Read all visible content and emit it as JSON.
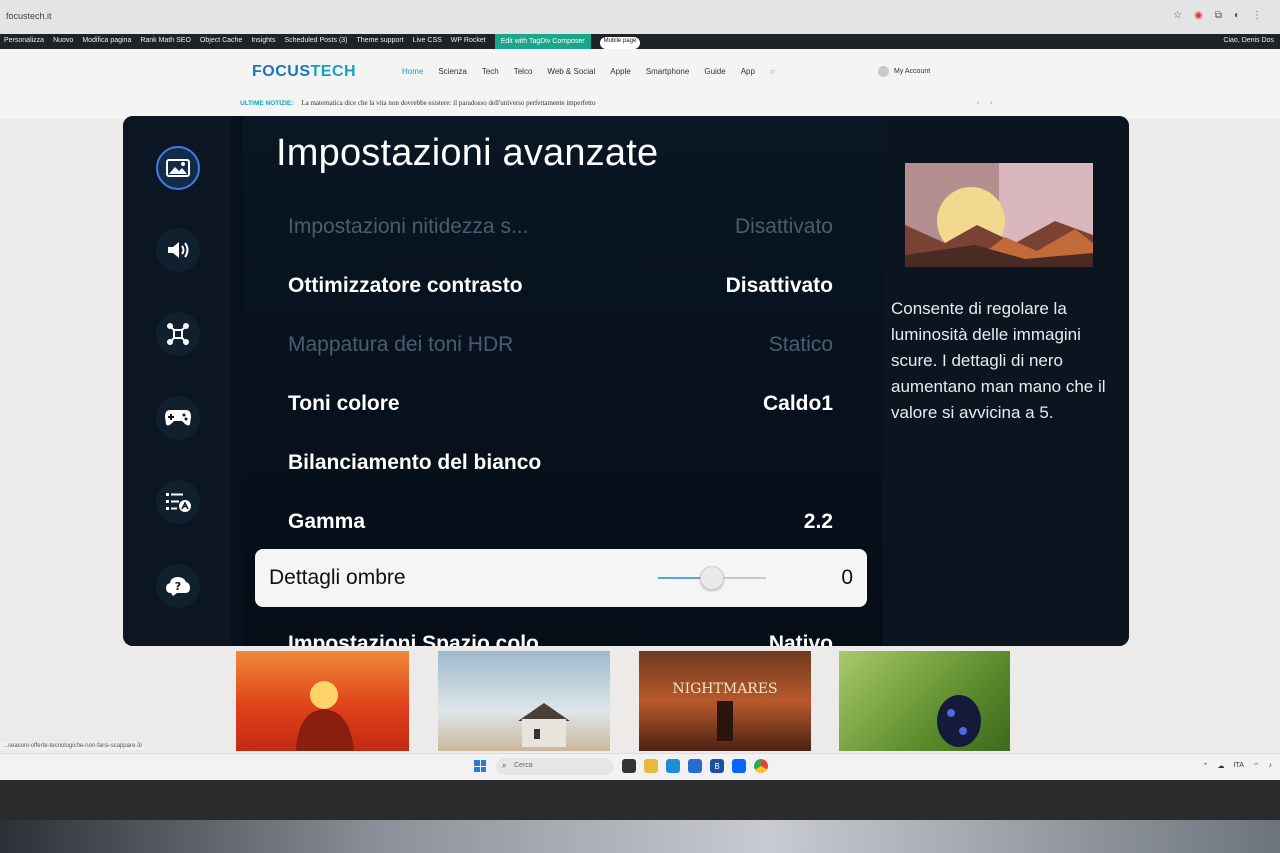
{
  "browser": {
    "url": "focustech.it"
  },
  "admin_bar": {
    "items": [
      "Personalizza",
      "Nuovo",
      "Modifica pagina",
      "Rank Math SEO",
      "Object Cache",
      "Insights",
      "Scheduled Posts (3)",
      "Theme support",
      "Live CSS",
      "WP Rocket"
    ],
    "tagdiv": "Edit with TagDiv Composer",
    "mobile": "Mobile page",
    "greeting": "Ciao, Denis Dos"
  },
  "site": {
    "logo_focus": "FOCUS",
    "logo_tech": "TECH",
    "nav": [
      "Home",
      "Scienza",
      "Tech",
      "Telco",
      "Web & Social",
      "Apple",
      "Smartphone",
      "Guide",
      "App"
    ],
    "account": "My Account",
    "ticker_label": "ULTIME NOTIZIE:",
    "ticker_text": "La matematica dice che la vita non dovrebbe esistere: il paradosso dell'universo perfettamente imperfetto"
  },
  "tv": {
    "title": "Impostazioni avanzate",
    "sidebar_icons": [
      "picture-icon",
      "sound-icon",
      "connection-icon",
      "game-icon",
      "accessibility-icon",
      "support-icon"
    ],
    "rows": [
      {
        "label": "Impostazioni nitidezza s...",
        "value": "Disattivato",
        "state": "disabled"
      },
      {
        "label": "Ottimizzatore contrasto",
        "value": "Disattivato",
        "state": "normal"
      },
      {
        "label": "Mappatura dei toni HDR",
        "value": "Statico",
        "state": "disabled"
      },
      {
        "label": "Toni colore",
        "value": "Caldo1",
        "state": "normal"
      },
      {
        "label": "Bilanciamento del bianco",
        "value": "",
        "state": "normal"
      },
      {
        "label": "Gamma",
        "value": "2.2",
        "state": "normal"
      }
    ],
    "selected": {
      "label": "Dettagli ombre",
      "value": "0",
      "slider_fraction": 0.5
    },
    "cut_row": {
      "label": "Impostazioni Spazio colo",
      "value": "Nativo"
    },
    "description": "Consente di regolare la luminosità delle immagini scure. I dettagli di nero aumentano man mano che il valore si avvicina a 5."
  },
  "taskbar": {
    "search_placeholder": "Cerca",
    "status_url": "...seasoni-offerte-tecnologiche-non-farsi-scappare-3/",
    "lang": "ITA"
  },
  "colors": {
    "accent": "#16a3c0",
    "tv_bg": "#07111c",
    "selection": "#3f7ee8"
  }
}
